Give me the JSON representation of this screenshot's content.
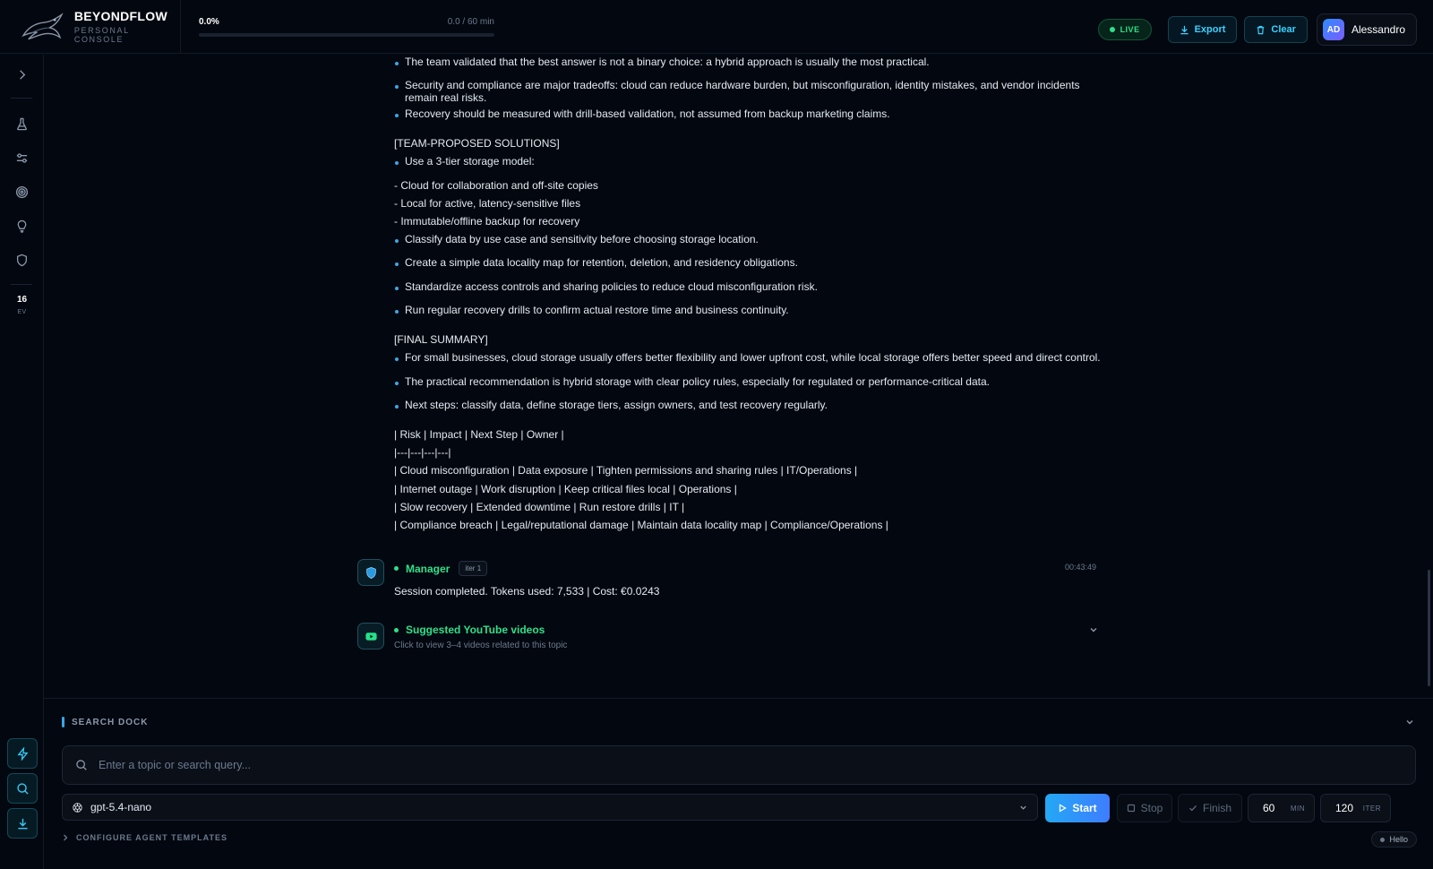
{
  "header": {
    "brand_title": "BEYONDFLOW",
    "brand_subtitle": "PERSONAL CONSOLE",
    "progress_percent_text": "0.0%",
    "progress_time_text": "0.0 / 60 min",
    "progress_fraction": 0.0,
    "live_label": "LIVE",
    "export_label": "Export",
    "clear_label": "Clear",
    "user_initials": "AD",
    "user_name": "Alessandro"
  },
  "sidebar": {
    "icons": [
      "chevron-right-icon",
      "flask-icon",
      "sliders-icon",
      "target-icon",
      "lightbulb-icon",
      "shield-icon"
    ],
    "ev_count": "16",
    "ev_label": "EV",
    "bottom_buttons": [
      "lightning-icon",
      "search-icon",
      "download-icon"
    ]
  },
  "content": {
    "intro_bullets": [
      "The team validated that the best answer is not a binary choice: a hybrid approach is usually the most practical.",
      "Security and compliance are major tradeoffs: cloud can reduce hardware burden, but misconfiguration, identity mistakes, and vendor incidents remain real risks.",
      "Recovery should be measured with drill-based validation, not assumed from backup marketing claims."
    ],
    "solutions_heading": "[TEAM-PROPOSED SOLUTIONS]",
    "solution_first": "Use a 3-tier storage model:",
    "solution_dash_lines": [
      "- Cloud for collaboration and off-site copies",
      "- Local for active, latency-sensitive files",
      "- Immutable/offline backup for recovery"
    ],
    "solution_bullets": [
      "Classify data by use case and sensitivity before choosing storage location.",
      "Create a simple data locality map for retention, deletion, and residency obligations.",
      "Standardize access controls and sharing policies to reduce cloud misconfiguration risk.",
      "Run regular recovery drills to confirm actual restore time and business continuity."
    ],
    "summary_heading": "[FINAL SUMMARY]",
    "summary_bullets": [
      "For small businesses, cloud storage usually offers better flexibility and lower upfront cost, while local storage offers better speed and direct control.",
      "The practical recommendation is hybrid storage with clear policy rules, especially for regulated or performance-critical data.",
      "Next steps: classify data, define storage tiers, assign owners, and test recovery regularly."
    ],
    "table_lines": [
      "| Risk | Impact | Next Step | Owner |",
      "|---|---|---|---|",
      "| Cloud misconfiguration | Data exposure | Tighten permissions and sharing rules | IT/Operations |",
      "| Internet outage | Work disruption | Keep critical files local | Operations |",
      "| Slow recovery | Extended downtime | Run restore drills | IT |",
      "| Compliance breach | Legal/reputational damage | Maintain data locality map | Compliance/Operations |"
    ]
  },
  "messages": {
    "manager": {
      "name": "Manager",
      "iter": "iter 1",
      "time": "00:43:49",
      "text": "Session completed. Tokens used: 7,533 | Cost: €0.0243"
    },
    "youtube": {
      "name": "Suggested YouTube videos",
      "subtitle": "Click to view 3–4 videos related to this topic"
    }
  },
  "dock": {
    "title": "SEARCH DOCK",
    "search_placeholder": "Enter a topic or search query...",
    "search_value": "",
    "model": "gpt-5.4-nano",
    "start_label": "Start",
    "stop_label": "Stop",
    "finish_label": "Finish",
    "minutes_value": "60",
    "minutes_unit": "MIN",
    "iter_value": "120",
    "iter_unit": "ITER",
    "config_label": "CONFIGURE AGENT TEMPLATES",
    "status_label": "Hello"
  },
  "colors": {
    "accent": "#37a6e8",
    "live_green": "#2ee08a",
    "cyan": "#39d2ff",
    "background": "#03070f"
  }
}
